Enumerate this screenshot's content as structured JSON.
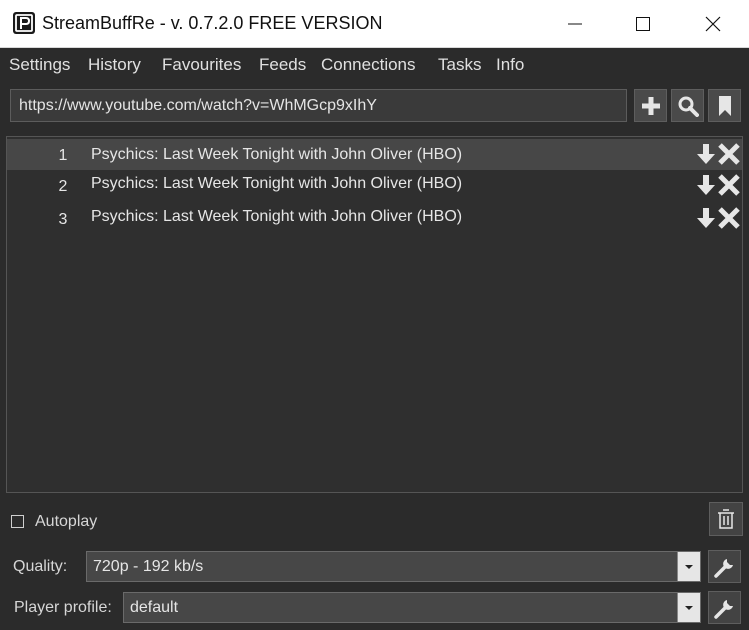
{
  "window": {
    "title": "StreamBuffRe - v. 0.7.2.0 FREE VERSION"
  },
  "menu": {
    "items": [
      {
        "label": "Settings"
      },
      {
        "label": "History"
      },
      {
        "label": "Favourites"
      },
      {
        "label": "Feeds"
      },
      {
        "label": "Connections"
      },
      {
        "label": "Tasks"
      },
      {
        "label": "Info"
      }
    ]
  },
  "url_bar": {
    "value": "https://www.youtube.com/watch?v=WhMGcp9xIhY"
  },
  "toolbar": {
    "icons": [
      "plus-icon",
      "search-icon",
      "bookmark-icon"
    ]
  },
  "list": {
    "rows": [
      {
        "num": "1",
        "title": "Psychics: Last Week Tonight with John Oliver (HBO)",
        "selected": true
      },
      {
        "num": "2",
        "title": "Psychics: Last Week Tonight with John Oliver (HBO)",
        "selected": false
      },
      {
        "num": "3",
        "title": "Psychics: Last Week Tonight with John Oliver (HBO)",
        "selected": false
      }
    ]
  },
  "autoplay": {
    "label": "Autoplay",
    "checked": false
  },
  "quality": {
    "label": "Quality:",
    "value": "720p - 192 kb/s"
  },
  "player_profile": {
    "label": "Player profile:",
    "value": "default"
  },
  "colors": {
    "background": "#2b2b2b",
    "selected_row": "#474747",
    "text": "#e6e6e6"
  }
}
